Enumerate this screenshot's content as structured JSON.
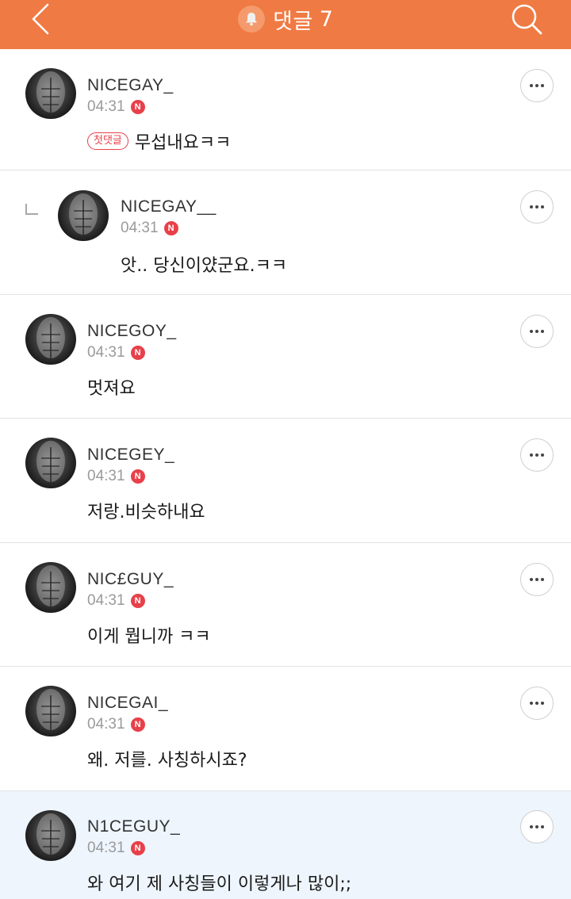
{
  "header": {
    "back_icon": "chevron-left-icon",
    "bell_icon": "bell-icon",
    "title": "댓글",
    "count": "7",
    "search_icon": "search-icon",
    "color": "#f07a43"
  },
  "comments": [
    {
      "nickname": "NICEGAY_",
      "time": "04:31",
      "new_badge": "N",
      "first_badge": "첫댓글",
      "text": "무섭내요ㅋㅋ",
      "reply": false
    },
    {
      "nickname": "NICEGAY__",
      "time": "04:31",
      "new_badge": "N",
      "text": "앗.. 당신이얐군요.ㅋㅋ",
      "reply": true
    },
    {
      "nickname": "NICEGOY_",
      "time": "04:31",
      "new_badge": "N",
      "text": "멋져요",
      "reply": false
    },
    {
      "nickname": "NICEGEY_",
      "time": "04:31",
      "new_badge": "N",
      "text": "저랑.비슷하내요",
      "reply": false
    },
    {
      "nickname": "NIC£GUY_",
      "time": "04:31",
      "new_badge": "N",
      "text": "이게 뭡니까 ㅋㅋ",
      "reply": false
    },
    {
      "nickname": "NICEGAI_",
      "time": "04:31",
      "new_badge": "N",
      "text": "왜. 저를. 사칭하시죠?",
      "reply": false
    },
    {
      "nickname": "N1CEGUY_",
      "time": "04:31",
      "new_badge": "N",
      "text": "와 여기 제 사칭들이 이렇게나 많이;;",
      "reply": false,
      "highlighted": true
    }
  ],
  "more_icon": "more-dots-icon",
  "badge_color": "#e8404a"
}
